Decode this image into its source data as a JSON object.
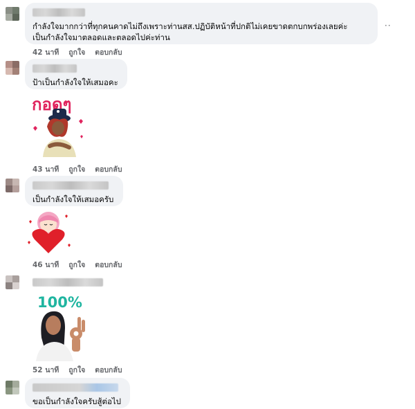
{
  "comments": [
    {
      "text": "กำลังใจมากกว่าที่ทุกคนคาดไม่ถึงเพราะท่านสส.ปฏิบัติหน้าที่ปกติไม่เคยขาดตกบกพร่องเลยค่ะ\nเป็นกำลังใจมาตลอดและตลอดไปค่ะท่าน",
      "time": "42 นาที",
      "like": "ถูกใจ",
      "reply": "ตอบกลับ",
      "more": "··"
    },
    {
      "text": "ป้าเป็นกำลังใจให้เสมอคะ",
      "time": "43 นาที",
      "like": "ถูกใจ",
      "reply": "ตอบกลับ",
      "sticker_text": "กอดๆ"
    },
    {
      "text": "เป็นกำลังใจให้เสมอครับ",
      "time": "46 นาที",
      "like": "ถูกใจ",
      "reply": "ตอบกลับ"
    },
    {
      "text": "",
      "time": "52 นาที",
      "like": "ถูกใจ",
      "reply": "ตอบกลับ",
      "sticker_text": "100%"
    },
    {
      "text": "ขอเป็นกำลังใจครับสู้ต่อไป"
    }
  ],
  "icons": {
    "sticker1": "hug-sticker-icon",
    "sticker2": "heart-sticker-icon",
    "sticker3": "ok-hand-sticker-icon"
  }
}
